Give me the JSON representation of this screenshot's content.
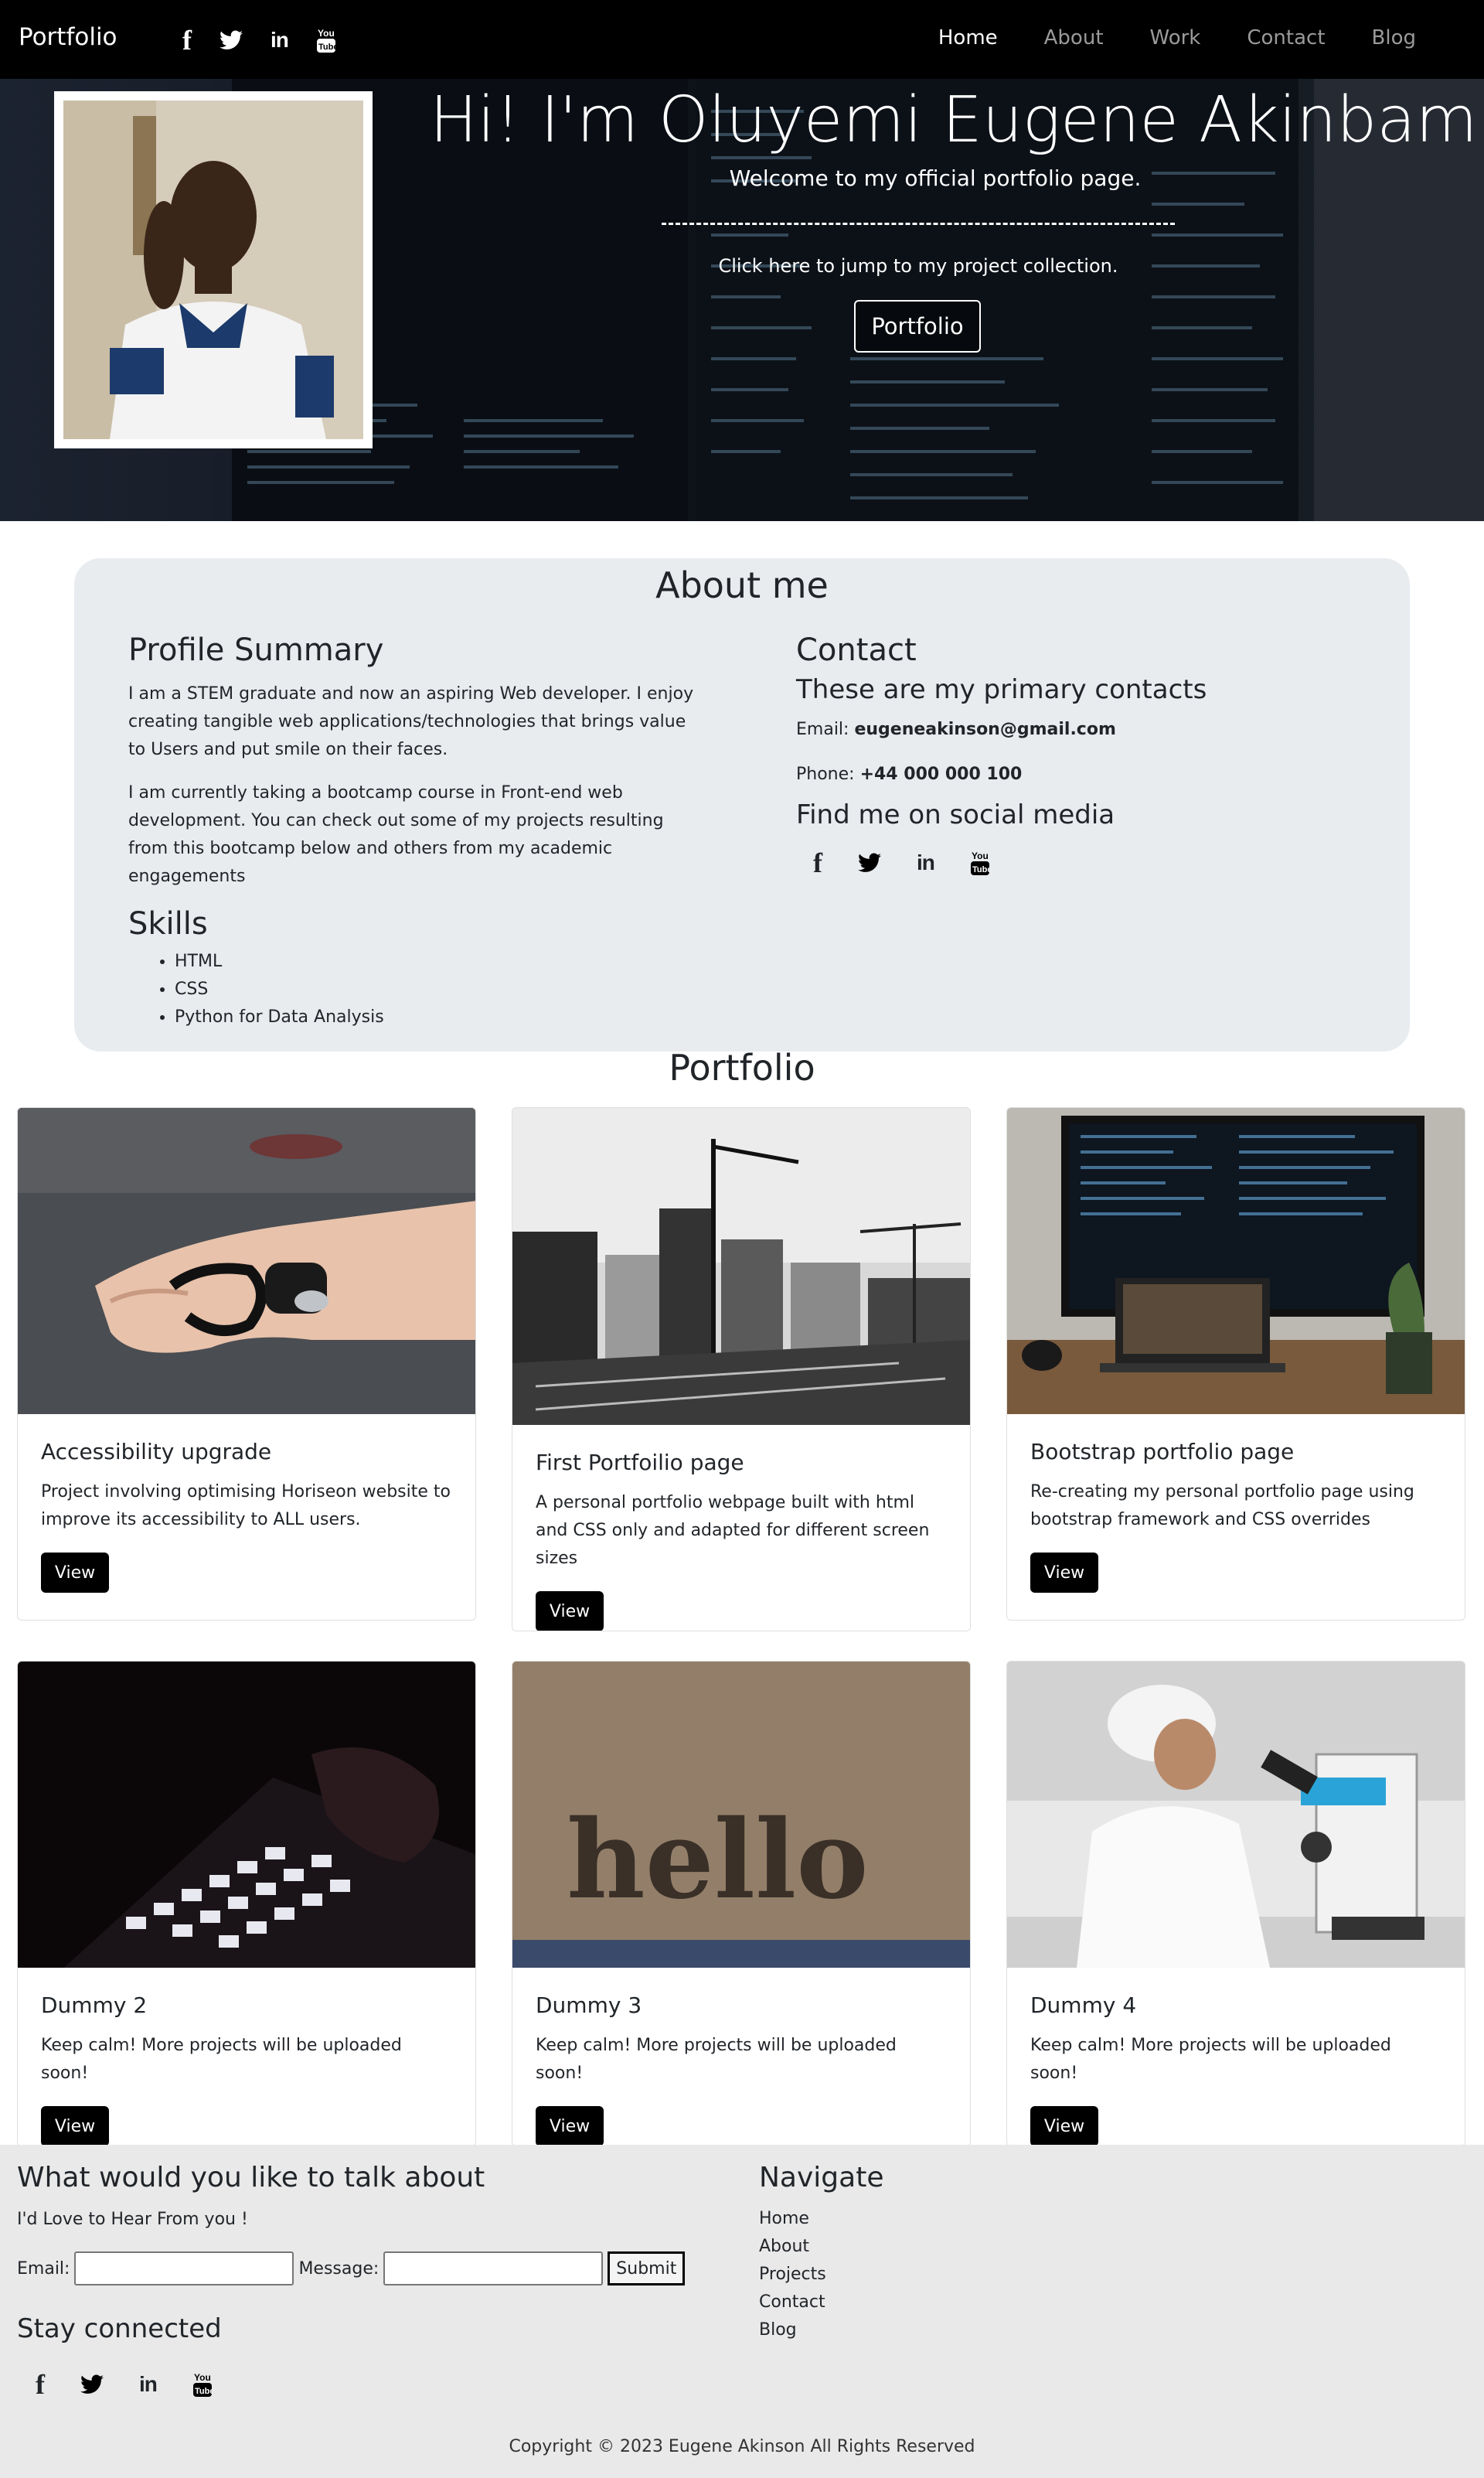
{
  "navbar": {
    "brand": "Portfolio",
    "social": [
      {
        "icon": "facebook-icon"
      },
      {
        "icon": "twitter-icon"
      },
      {
        "icon": "linkedin-icon"
      },
      {
        "icon": "youtube-icon"
      }
    ],
    "links": [
      {
        "label": "Home",
        "active": true
      },
      {
        "label": "About",
        "active": false
      },
      {
        "label": "Work",
        "active": false
      },
      {
        "label": "Contact",
        "active": false
      },
      {
        "label": "Blog",
        "active": false
      }
    ]
  },
  "hero": {
    "title": "Hi! I'm Oluyemi Eugene Akinbamini",
    "subtitle": "Welcome to my official portfolio page.",
    "jump_text": "Click here to jump to my project collection.",
    "button": "Portfolio"
  },
  "about": {
    "title": "About me",
    "profile_heading": "Profile Summary",
    "profile_p1": "I am a STEM graduate and now an aspiring Web developer. I enjoy creating tangible web applications/technologies that brings value to Users and put smile on their faces.",
    "profile_p2": "I am currently taking a bootcamp course in Front-end web development. You can check out some of my projects resulting from this bootcamp below and others from my academic engagements",
    "skills_heading": "Skills",
    "skills": [
      "HTML",
      "CSS",
      "Python for Data Analysis"
    ],
    "contact_heading": "Contact",
    "contact_sub": "These are my primary contacts",
    "email_label": "Email:",
    "email": "eugeneakinson@gmail.com",
    "phone_label": "Phone:",
    "phone": "+44 000 000 100",
    "social_heading": "Find me on social media"
  },
  "portfolio": {
    "title": "Portfolio",
    "cards": [
      {
        "title": "Accessibility upgrade",
        "text": "Project involving optimising Horiseon website to improve its accessibility to ALL users.",
        "button": "View",
        "image": "wearable-device-on-hand"
      },
      {
        "title": "First Portfoilio page",
        "text": "A personal portfolio webpage built with html and CSS only and adapted for different screen sizes",
        "button": "View",
        "image": "city-construction-cranes"
      },
      {
        "title": "Bootstrap portfolio page",
        "text": "Re-creating my personal portfolio page using bootstrap framework and CSS overrides",
        "button": "View",
        "image": "monitor-with-code"
      },
      {
        "title": "Dummy 2",
        "text": "Keep calm! More projects will be uploaded soon!",
        "button": "View",
        "image": "backlit-keyboard"
      },
      {
        "title": "Dummy 3",
        "text": "Keep calm! More projects will be uploaded soon!",
        "button": "View",
        "image": "hello-doormat"
      },
      {
        "title": "Dummy 4",
        "text": "Keep calm! More projects will be uploaded soon!",
        "button": "View",
        "image": "scientist-microscope"
      }
    ]
  },
  "footer": {
    "title": "What would you like to talk about",
    "subtitle": "I'd Love to Hear From you !",
    "email_label": "Email:",
    "message_label": "Message:",
    "email_value": "",
    "message_value": "",
    "submit": "Submit",
    "stay_connected": "Stay connected",
    "nav_title": "Navigate",
    "nav": [
      "Home",
      "About",
      "Projects",
      "Contact",
      "Blog"
    ],
    "copyright": "Copyright © 2023 Eugene Akinson All Rights Reserved"
  }
}
